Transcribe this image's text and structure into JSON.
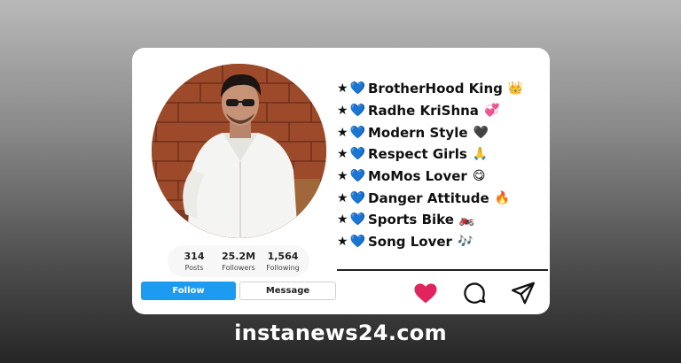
{
  "profile": {
    "stats": [
      {
        "value": "314",
        "label": "Posts"
      },
      {
        "value": "25.2M",
        "label": "Followers"
      },
      {
        "value": "1,564",
        "label": "Following"
      }
    ],
    "follow_label": "Follow",
    "message_label": "Message"
  },
  "bio": {
    "prefix_star": "★",
    "prefix_heart": "💙",
    "lines": [
      {
        "text": "BrotherHood King",
        "emoji": "👑"
      },
      {
        "text": "Radhe KriShna",
        "emoji": "💞"
      },
      {
        "text": "Modern Style",
        "emoji": "🖤"
      },
      {
        "text": "Respect Girls",
        "emoji": "🙏"
      },
      {
        "text": "MoMos Lover",
        "emoji": "😋"
      },
      {
        "text": "Danger Attitude",
        "emoji": "🔥"
      },
      {
        "text": "Sports Bike",
        "emoji": "🏍️"
      },
      {
        "text": "Song Lover",
        "emoji": "🎶"
      }
    ]
  },
  "icons": {
    "like": "heart-icon",
    "comment": "comment-icon",
    "share": "send-icon"
  },
  "colors": {
    "follow_button": "#1d9bf0",
    "heart": "#e0245e",
    "card": "#ffffff"
  },
  "footer": {
    "site": "instanews24.com"
  }
}
